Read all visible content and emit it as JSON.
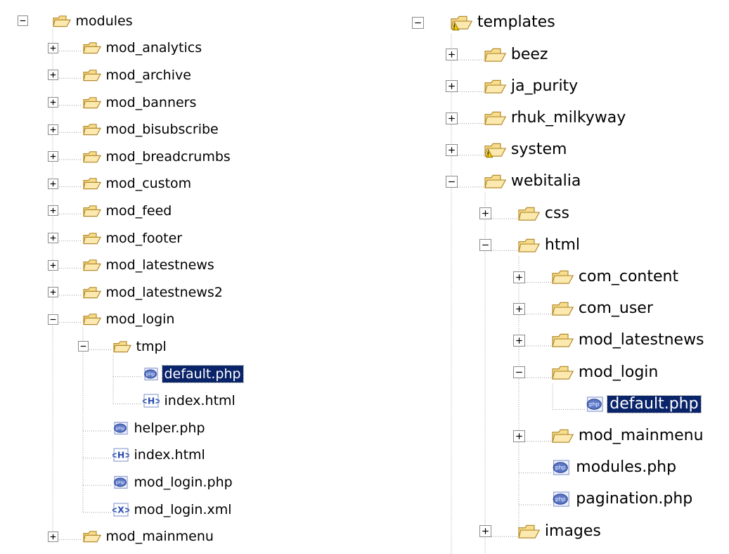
{
  "colors": {
    "selection_bg": "#0a246a",
    "folder_fill": "#f7de8e",
    "folder_stroke": "#b58a2a",
    "file_blue": "#2a4bb0",
    "tree_line": "#9a9a9a"
  },
  "left_tree": [
    {
      "label": "modules",
      "depth": 0,
      "icon": "folder-icon",
      "toggle": "minus",
      "line_to": 19
    },
    {
      "label": "mod_analytics",
      "depth": 1,
      "icon": "folder-icon",
      "toggle": "plus"
    },
    {
      "label": "mod_archive",
      "depth": 1,
      "icon": "folder-icon",
      "toggle": "plus"
    },
    {
      "label": "mod_banners",
      "depth": 1,
      "icon": "folder-icon",
      "toggle": "plus"
    },
    {
      "label": "mod_bisubscribe",
      "depth": 1,
      "icon": "folder-icon",
      "toggle": "plus"
    },
    {
      "label": "mod_breadcrumbs",
      "depth": 1,
      "icon": "folder-icon",
      "toggle": "plus"
    },
    {
      "label": "mod_custom",
      "depth": 1,
      "icon": "folder-icon",
      "toggle": "plus"
    },
    {
      "label": "mod_feed",
      "depth": 1,
      "icon": "folder-icon",
      "toggle": "plus"
    },
    {
      "label": "mod_footer",
      "depth": 1,
      "icon": "folder-icon",
      "toggle": "plus"
    },
    {
      "label": "mod_latestnews",
      "depth": 1,
      "icon": "folder-icon",
      "toggle": "plus"
    },
    {
      "label": "mod_latestnews2",
      "depth": 1,
      "icon": "folder-icon",
      "toggle": "plus"
    },
    {
      "label": "mod_login",
      "depth": 1,
      "icon": "folder-icon",
      "toggle": "minus",
      "line_to": 18
    },
    {
      "label": "tmpl",
      "depth": 2,
      "icon": "folder-icon",
      "toggle": "minus",
      "line_to": 14
    },
    {
      "label": "default.php",
      "depth": 3,
      "icon": "php-file-icon",
      "selected": true
    },
    {
      "label": "index.html",
      "depth": 3,
      "icon": "html-file-icon"
    },
    {
      "label": "helper.php",
      "depth": 2,
      "icon": "php-file-icon"
    },
    {
      "label": "index.html",
      "depth": 2,
      "icon": "html-file-icon"
    },
    {
      "label": "mod_login.php",
      "depth": 2,
      "icon": "php-file-icon"
    },
    {
      "label": "mod_login.xml",
      "depth": 2,
      "icon": "xml-file-icon"
    },
    {
      "label": "mod_mainmenu",
      "depth": 1,
      "icon": "folder-icon",
      "toggle": "plus"
    }
  ],
  "right_tree": [
    {
      "label": "templates",
      "depth": 0,
      "icon": "folder-warning-icon",
      "toggle": "minus",
      "line_to": 18
    },
    {
      "label": "beez",
      "depth": 1,
      "icon": "folder-icon",
      "toggle": "plus"
    },
    {
      "label": "ja_purity",
      "depth": 1,
      "icon": "folder-icon",
      "toggle": "plus"
    },
    {
      "label": "rhuk_milkyway",
      "depth": 1,
      "icon": "folder-icon",
      "toggle": "plus"
    },
    {
      "label": "system",
      "depth": 1,
      "icon": "folder-warning-icon",
      "toggle": "plus"
    },
    {
      "label": "webitalia",
      "depth": 1,
      "icon": "folder-icon",
      "toggle": "minus",
      "line_to": 18
    },
    {
      "label": "css",
      "depth": 2,
      "icon": "folder-icon",
      "toggle": "plus"
    },
    {
      "label": "html",
      "depth": 2,
      "icon": "folder-icon",
      "toggle": "minus",
      "line_to": 16
    },
    {
      "label": "com_content",
      "depth": 3,
      "icon": "folder-icon",
      "toggle": "plus"
    },
    {
      "label": "com_user",
      "depth": 3,
      "icon": "folder-icon",
      "toggle": "plus"
    },
    {
      "label": "mod_latestnews",
      "depth": 3,
      "icon": "folder-icon",
      "toggle": "plus"
    },
    {
      "label": "mod_login",
      "depth": 3,
      "icon": "folder-icon",
      "toggle": "minus",
      "line_to": 12
    },
    {
      "label": "default.php",
      "depth": 4,
      "icon": "php-file-icon",
      "selected": true
    },
    {
      "label": "mod_mainmenu",
      "depth": 3,
      "icon": "folder-icon",
      "toggle": "plus"
    },
    {
      "label": "modules.php",
      "depth": 3,
      "icon": "php-file-icon"
    },
    {
      "label": "pagination.php",
      "depth": 3,
      "icon": "php-file-icon"
    },
    {
      "label": "images",
      "depth": 2,
      "icon": "folder-icon",
      "toggle": "plus"
    }
  ]
}
